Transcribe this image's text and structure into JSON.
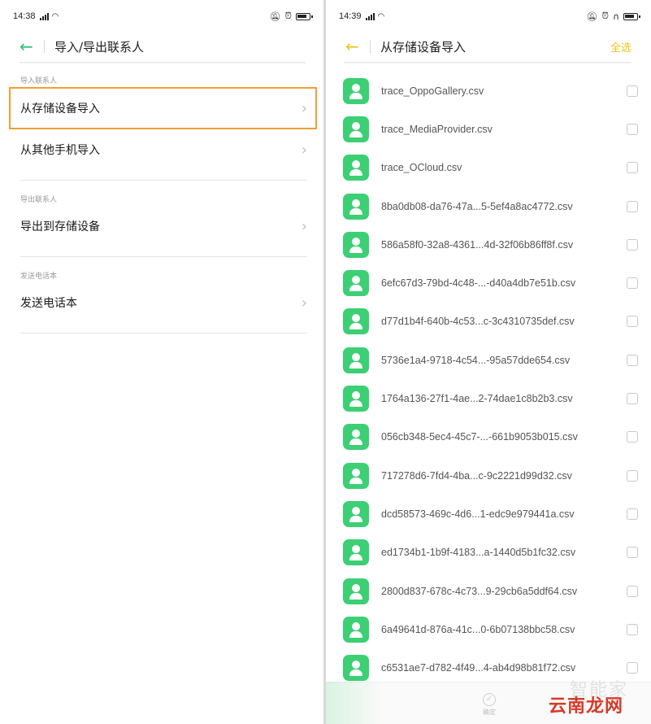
{
  "left": {
    "status": {
      "time": "14:38"
    },
    "nav": {
      "title": "导入/导出联系人"
    },
    "import_header": "导入联系人",
    "import_from_storage": "从存储设备导入",
    "import_from_phone": "从其他手机导入",
    "export_header": "导出联系人",
    "export_to_storage": "导出到存储设备",
    "send_header": "发送电话本",
    "send_contacts": "发送电话本"
  },
  "right": {
    "status": {
      "time": "14:39"
    },
    "nav": {
      "title": "从存储设备导入",
      "select_all": "全选"
    },
    "files": [
      "trace_OppoGallery.csv",
      "trace_MediaProvider.csv",
      "trace_OCloud.csv",
      "8ba0db08-da76-47a...5-5ef4a8ac4772.csv",
      "586a58f0-32a8-4361...4d-32f06b86ff8f.csv",
      "6efc67d3-79bd-4c48-...-d40a4db7e51b.csv",
      "d77d1b4f-640b-4c53...c-3c4310735def.csv",
      "5736e1a4-9718-4c54...-95a57dde654.csv",
      "1764a136-27f1-4ae...2-74dae1c8b2b3.csv",
      "056cb348-5ec4-45c7-...-661b9053b015.csv",
      "717278d6-7fd4-4ba...c-9c2221d99d32.csv",
      "dcd58573-469c-4d6...1-edc9e979441a.csv",
      "ed1734b1-1b9f-4183...a-1440d5b1fc32.csv",
      "2800d837-678c-4c73...9-29cb6a5ddf64.csv",
      "6a49641d-876a-41c...0-6b07138bbc58.csv",
      "c6531ae7-d782-4f49...4-ab4d98b81f72.csv"
    ],
    "confirm_label": "确定",
    "watermark_top": "智能家",
    "watermark_bottom": "云南龙网"
  },
  "colors": {
    "left_accent": "#2fbf71",
    "right_accent": "#f5c218",
    "highlight_border": "#f0a030",
    "icon_green": "#3ccf74"
  }
}
